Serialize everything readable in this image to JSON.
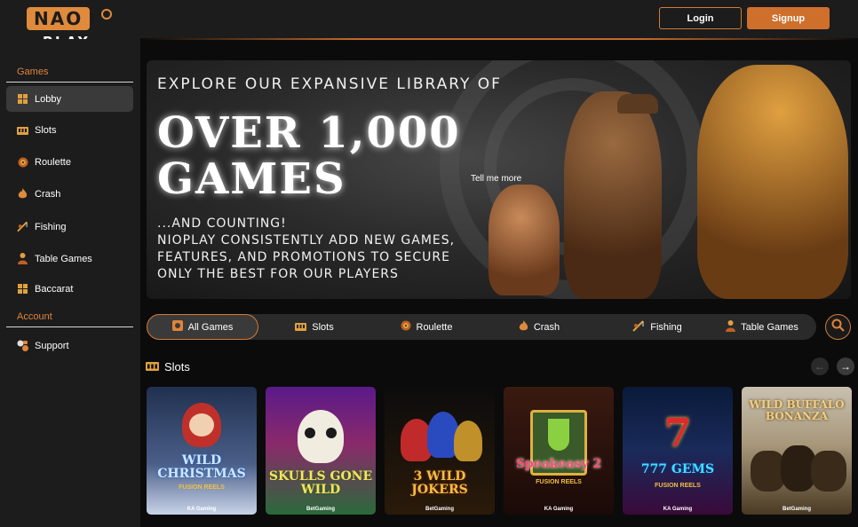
{
  "brand": {
    "logo_text": "NAO",
    "logo_sub": "PLAY"
  },
  "header": {
    "login_label": "Login",
    "signup_label": "Signup"
  },
  "sidebar": {
    "games_title": "Games",
    "items": [
      {
        "label": "Lobby",
        "icon": "grid-icon"
      },
      {
        "label": "Slots",
        "icon": "slot-machine-icon"
      },
      {
        "label": "Roulette",
        "icon": "roulette-icon"
      },
      {
        "label": "Crash",
        "icon": "flame-icon"
      },
      {
        "label": "Fishing",
        "icon": "fishing-rod-icon"
      },
      {
        "label": "Table Games",
        "icon": "dealer-icon"
      },
      {
        "label": "Baccarat",
        "icon": "grid-icon"
      }
    ],
    "account_title": "Account",
    "account_items": [
      {
        "label": "Support",
        "icon": "support-icon"
      }
    ]
  },
  "hero": {
    "line1": "EXPLORE OUR EXPANSIVE LIBRARY OF",
    "big1": "OVER 1,000",
    "big2": "GAMES",
    "line2": "...AND COUNTING!",
    "line3": "NIOPLAY CONSISTENTLY ADD NEW GAMES,",
    "line4": "FEATURES, AND PROMOTIONS TO SECURE",
    "line5": "ONLY THE BEST FOR OUR PLAYERS",
    "tell_more": "Tell me more"
  },
  "categories": [
    {
      "label": "All Games",
      "icon": "all-games-icon",
      "active": true
    },
    {
      "label": "Slots",
      "icon": "slot-machine-icon"
    },
    {
      "label": "Roulette",
      "icon": "roulette-icon"
    },
    {
      "label": "Crash",
      "icon": "flame-icon"
    },
    {
      "label": "Fishing",
      "icon": "fishing-rod-icon"
    },
    {
      "label": "Table Games",
      "icon": "dealer-icon"
    }
  ],
  "slots_section": {
    "title": "Slots"
  },
  "games": [
    {
      "title": "WILD CHRISTMAS",
      "sub": "FUSION REELS",
      "provider": "KA Gaming",
      "colors": [
        "#20304f",
        "#6a7ea8"
      ]
    },
    {
      "title": "SKULLS GONE WILD",
      "sub": "",
      "provider": "BetGaming",
      "colors": [
        "#5a1a8a",
        "#2a6a3a"
      ]
    },
    {
      "title": "3 WILD JOKERS",
      "sub": "",
      "provider": "BetGaming",
      "colors": [
        "#101010",
        "#3a2a10"
      ]
    },
    {
      "title": "Speakeasy 2",
      "sub": "FUSION REELS",
      "provider": "KA Gaming",
      "colors": [
        "#3a1a10",
        "#1a0a08"
      ]
    },
    {
      "title": "777 GEMS",
      "sub": "FUSION REELS",
      "provider": "KA Gaming",
      "colors": [
        "#0a1a3a",
        "#3a0a3a"
      ]
    },
    {
      "title": "WILD BUFFALO BONANZA",
      "sub": "",
      "provider": "BetGaming",
      "colors": [
        "#c8c0b0",
        "#6a5a40"
      ]
    }
  ],
  "colors": {
    "accent": "#cf6f2c",
    "sidebar_bg": "#1c1c1c",
    "page_bg": "#0b0b0b"
  }
}
